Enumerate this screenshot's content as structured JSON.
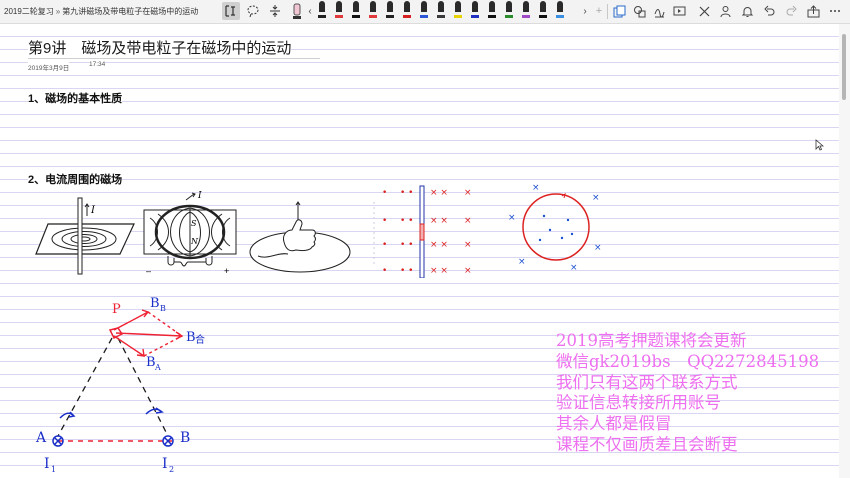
{
  "breadcrumb": {
    "notebook": "2019二轮复习",
    "separator": "»",
    "page": "第九讲磁场及带电粒子在磁场中的运动"
  },
  "page": {
    "title": "第9讲　磁场及带电粒子在磁场中的运动",
    "date": "2019年3月9日",
    "time": "17:34",
    "heading1": "1、磁场的基本性质",
    "heading2": "2、电流周围的磁场"
  },
  "toolbar": {
    "tools": [
      "select-text-icon",
      "lasso-icon",
      "insert-space-icon",
      "eraser-icon"
    ],
    "pen_colors": [
      "#222222",
      "#e03a3a",
      "#111111",
      "#e03a3a",
      "#222222",
      "#d32020",
      "#2b56d6",
      "#3a3a3a",
      "#e8d300",
      "#2030c0",
      "#111111",
      "#2a8c2a",
      "#a04ac8",
      "#111111",
      "#3a8fe0"
    ],
    "right_icons": [
      "add-page-icon",
      "ink-to-shape-icon",
      "ink-to-text-icon",
      "replay-icon",
      "close-icon",
      "bell-icon",
      "undo-icon",
      "redo-icon",
      "share-icon",
      "more-icon"
    ]
  },
  "figures": {
    "fig1_label": "I",
    "fig2_labels": [
      "I",
      "S",
      "N",
      "–",
      "+"
    ],
    "handwriting": {
      "P": "P",
      "B_B": "B",
      "B_B_sub": "B",
      "B_he": "B",
      "B_he_sub": "合",
      "B_A": "B",
      "B_A_sub": "A",
      "A": "A",
      "B": "B",
      "I1": "I",
      "I1_sub": "1",
      "I2": "I",
      "I2_sub": "2"
    }
  },
  "watermark": [
    "2019高考押题课将会更新",
    "微信gk2019bs　QQ2272845198",
    "我们只有这两个联系方式",
    "验证信息转接所用账号",
    "其余人都是假冒",
    "课程不仅画质差且会断更"
  ]
}
